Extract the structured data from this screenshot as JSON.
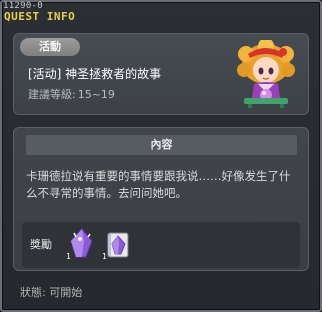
{
  "window": {
    "quest_id": "11290-0",
    "title": "QUEST INFO"
  },
  "header": {
    "type_label": "活動",
    "quest_title": "[活动] 神圣拯救者的故事",
    "level_label": "建議等級:",
    "level_range": "15~19"
  },
  "content": {
    "section_title": "內容",
    "description": "卡珊德拉说有重要的事情要跟我说……好像发生了什么不寻常的事情。去问问她吧。"
  },
  "rewards": {
    "label": "獎勵",
    "items": [
      {
        "icon": "purple-crystal-icon",
        "count": "1"
      },
      {
        "icon": "purple-book-icon",
        "count": "1"
      }
    ]
  },
  "footer": {
    "status": "狀態: 可開始"
  },
  "colors": {
    "title_yellow": "#e3d04a",
    "panel": "#474c53",
    "purple": "#8b5cd6"
  }
}
